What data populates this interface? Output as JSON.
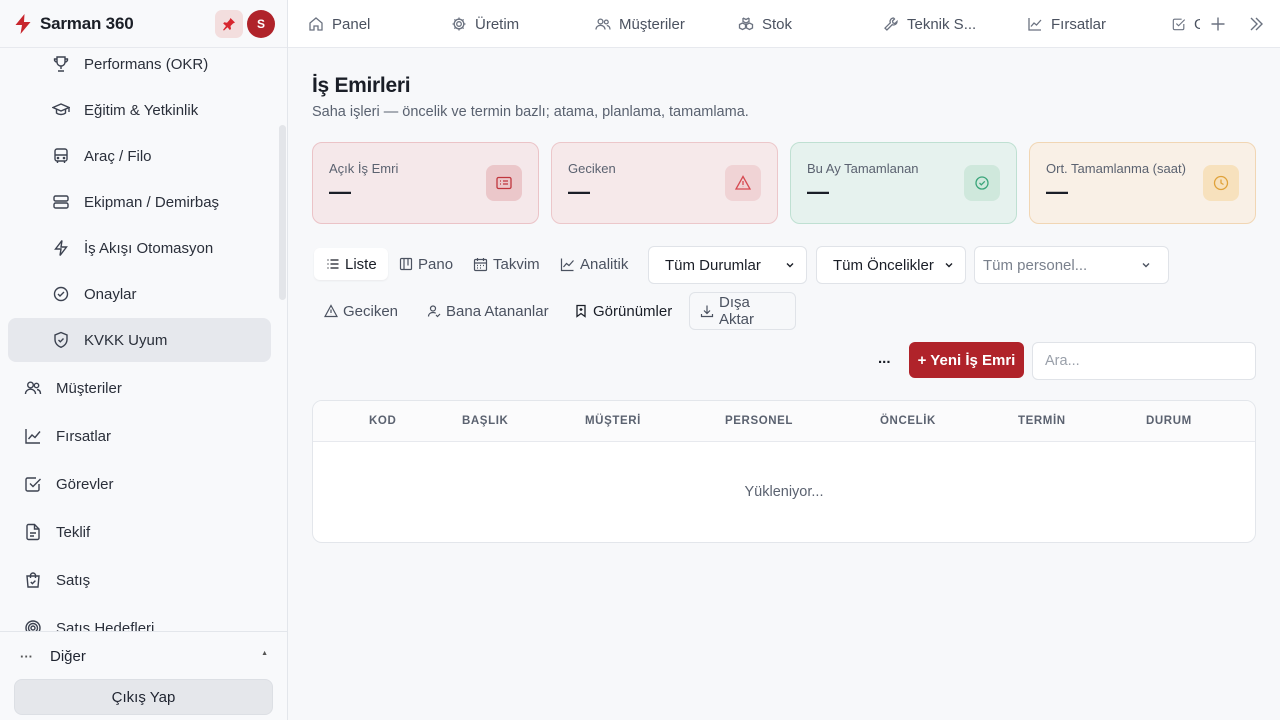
{
  "app": {
    "name": "Sarman 360",
    "avatar_initial": "S",
    "accent_color": "#b0232a"
  },
  "sidebar": {
    "sub_items": [
      {
        "label": "Performans (OKR)",
        "icon": "trophy-icon"
      },
      {
        "label": "Eğitim & Yetkinlik",
        "icon": "graduation-cap-icon"
      },
      {
        "label": "Araç / Filo",
        "icon": "bus-icon"
      },
      {
        "label": "Ekipman / Demirbaş",
        "icon": "server-icon"
      },
      {
        "label": "İş Akışı Otomasyon",
        "icon": "lightning-icon"
      },
      {
        "label": "Onaylar",
        "icon": "check-circle-icon"
      },
      {
        "label": "KVKK Uyum",
        "icon": "shield-icon"
      }
    ],
    "top_items": [
      {
        "label": "Müşteriler",
        "icon": "users-icon"
      },
      {
        "label": "Fırsatlar",
        "icon": "trend-chart-icon"
      },
      {
        "label": "Görevler",
        "icon": "checkbox-icon"
      },
      {
        "label": "Teklif",
        "icon": "document-icon"
      },
      {
        "label": "Satış",
        "icon": "shopping-bag-icon"
      },
      {
        "label": "Satış Hedefleri",
        "icon": "target-icon"
      }
    ],
    "active_item": "KVKK Uyum",
    "other_label": "Diğer",
    "logout_label": "Çıkış Yap"
  },
  "tabs": [
    {
      "label": "Panel",
      "icon": "home-icon"
    },
    {
      "label": "Üretim",
      "icon": "gear-icon"
    },
    {
      "label": "Müşteriler",
      "icon": "users-icon"
    },
    {
      "label": "Stok",
      "icon": "boxes-icon"
    },
    {
      "label": "Teknik S...",
      "icon": "wrench-icon"
    },
    {
      "label": "Fırsatlar",
      "icon": "trend-chart-icon"
    },
    {
      "label": "G",
      "icon": "checkbox-icon"
    }
  ],
  "page": {
    "title": "İş Emirleri",
    "subtitle": "Saha işleri — öncelik ve termin bazlı; atama, planlama, tamamlama."
  },
  "stats": [
    {
      "label": "Açık İş Emri",
      "value": "—",
      "icon": "list-card-icon",
      "icon_color": "#c0363d"
    },
    {
      "label": "Geciken",
      "value": "—",
      "icon": "warning-icon",
      "icon_color": "#d64a52"
    },
    {
      "label": "Bu Ay Tamamlanan",
      "value": "—",
      "icon": "check-circle-icon",
      "icon_color": "#3aa57a"
    },
    {
      "label": "Ort. Tamamlanma (saat)",
      "value": "—",
      "icon": "clock-icon",
      "icon_color": "#e0a23a"
    }
  ],
  "views": [
    {
      "label": "Liste",
      "icon": "list-icon"
    },
    {
      "label": "Pano",
      "icon": "board-icon"
    },
    {
      "label": "Takvim",
      "icon": "calendar-icon"
    },
    {
      "label": "Analitik",
      "icon": "trend-chart-icon"
    }
  ],
  "active_view": "Liste",
  "filters": {
    "status": "Tüm Durumlar",
    "priority": "Tüm Öncelikler",
    "personnel_placeholder": "Tüm personel..."
  },
  "quick_filters": {
    "overdue": "Geciken",
    "assigned_to_me": "Bana Atananlar",
    "views": "Görünümler",
    "export": "Dışa Aktar"
  },
  "actions": {
    "more": "...",
    "new_order": "+ Yeni İş Emri",
    "search_placeholder": "Ara..."
  },
  "table": {
    "columns": [
      "KOD",
      "BAŞLIK",
      "MÜŞTERİ",
      "PERSONEL",
      "ÖNCELİK",
      "TERMİN",
      "DURUM"
    ],
    "loading_text": "Yükleniyor..."
  }
}
